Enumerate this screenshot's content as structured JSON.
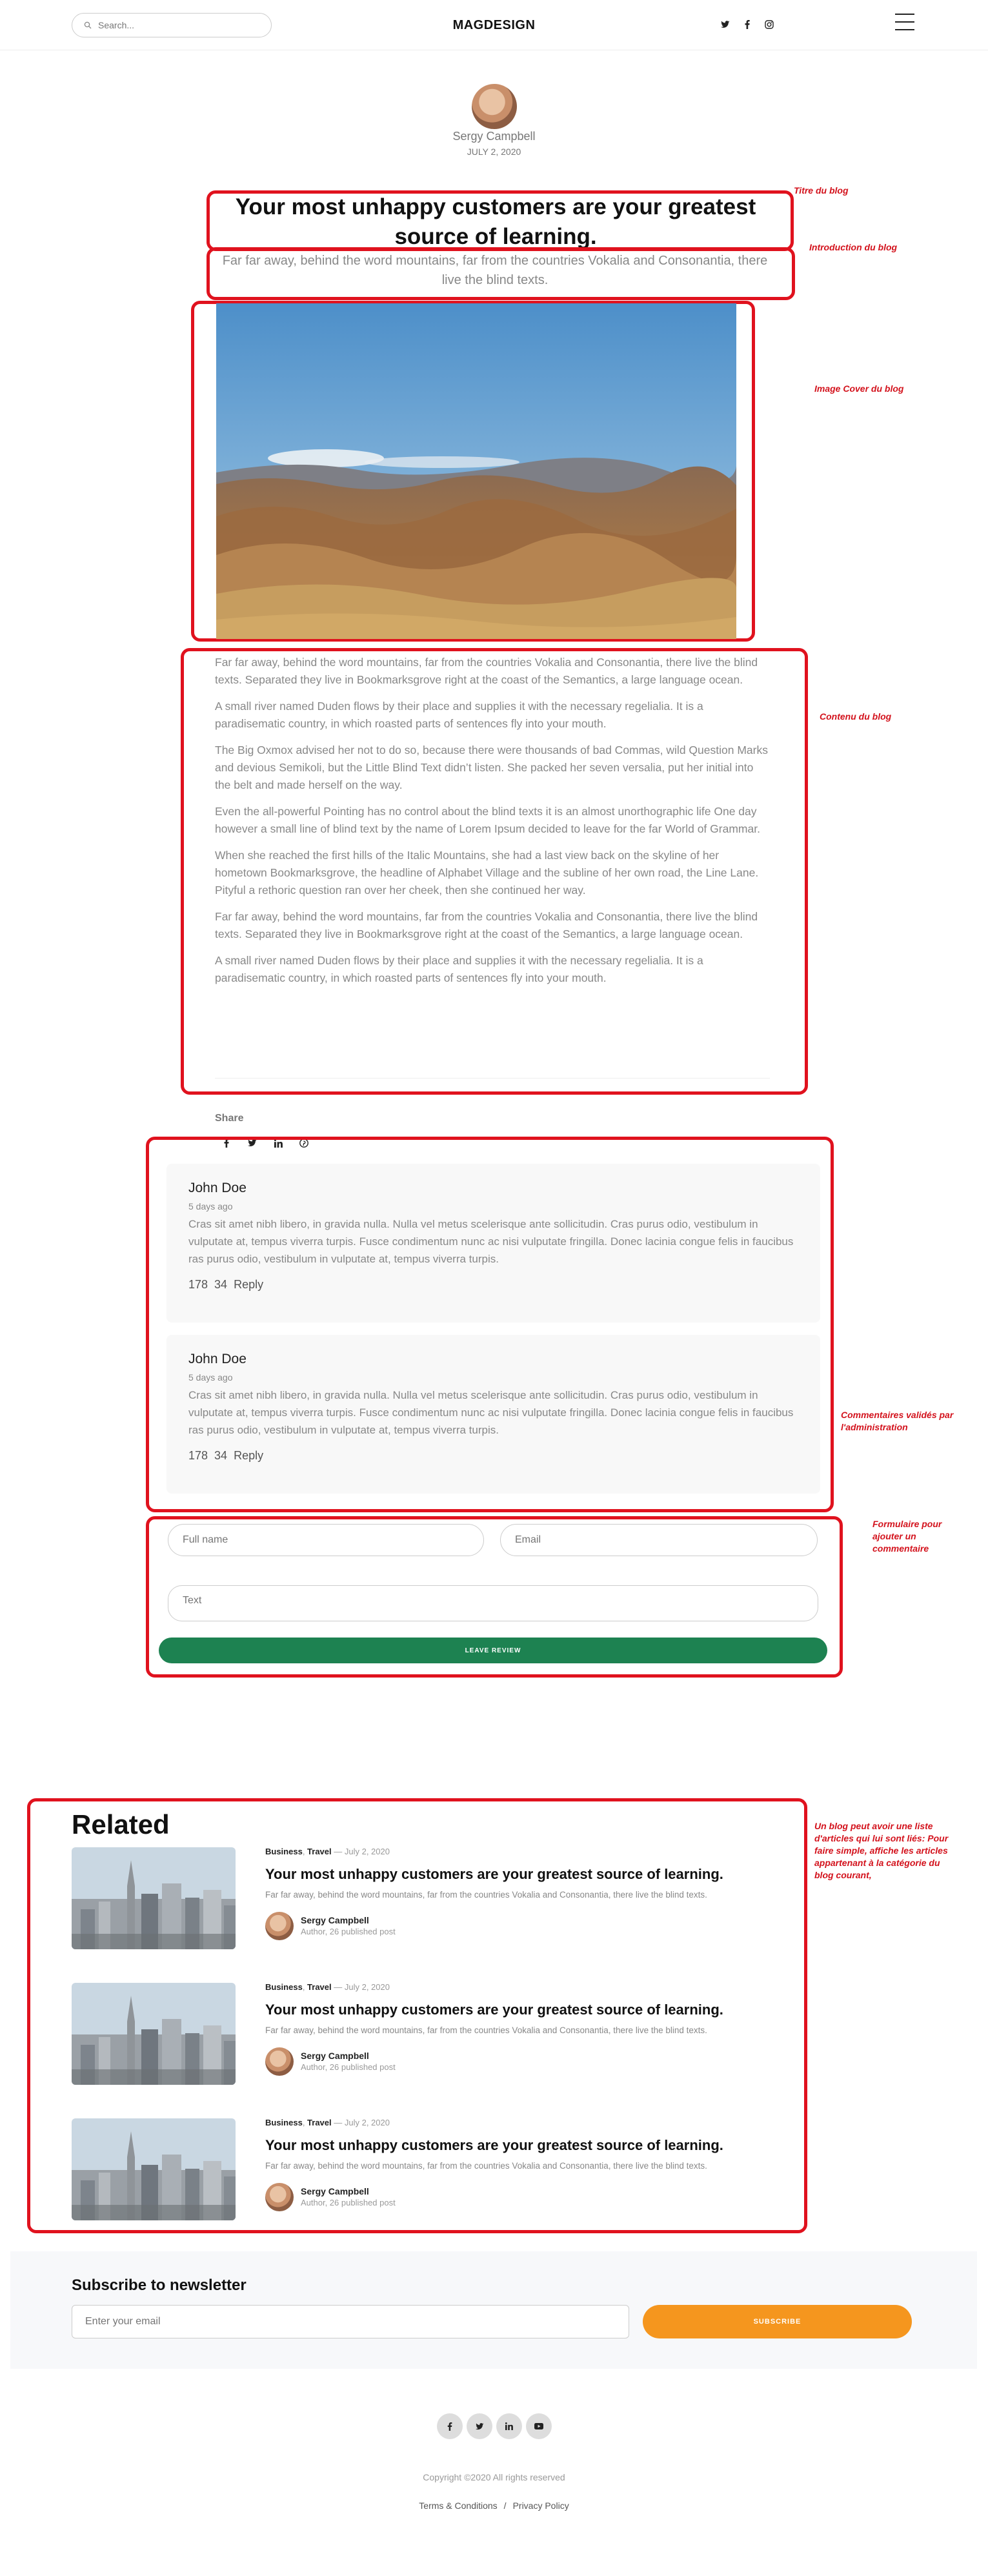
{
  "header": {
    "search_placeholder": "Search...",
    "logo": "MAGDESIGN",
    "social_icons": [
      "twitter-icon",
      "facebook-icon",
      "instagram-icon"
    ]
  },
  "post": {
    "author": "Sergy Campbell",
    "date": "JULY 2, 2020",
    "title": "Your most unhappy customers are your greatest source of learning.",
    "intro": "Far far away, behind the word mountains, far from the countries Vokalia and Consonantia, there live the blind texts.",
    "paragraphs": [
      "Far far away, behind the word mountains, far from the countries Vokalia and Consonantia, there live the blind texts. Separated they live in Bookmarksgrove right at the coast of the Semantics, a large language ocean.",
      "A small river named Duden flows by their place and supplies it with the necessary regelialia. It is a paradisematic country, in which roasted parts of sentences fly into your mouth.",
      "The Big Oxmox advised her not to do so, because there were thousands of bad Commas, wild Question Marks and devious Semikoli, but the Little Blind Text didn’t listen. She packed her seven versalia, put her initial into the belt and made herself on the way.",
      "Even the all-powerful Pointing has no control about the blind texts it is an almost unorthographic life One day however a small line of blind text by the name of Lorem Ipsum decided to leave for the far World of Grammar.",
      "When she reached the first hills of the Italic Mountains, she had a last view back on the skyline of her hometown Bookmarksgrove, the headline of Alphabet Village and the subline of her own road, the Line Lane. Pityful a rethoric question ran over her cheek, then she continued her way.",
      "Far far away, behind the word mountains, far from the countries Vokalia and Consonantia, there live the blind texts. Separated they live in Bookmarksgrove right at the coast of the Semantics, a large language ocean.",
      "A small river named Duden flows by their place and supplies it with the necessary regelialia. It is a paradisematic country, in which roasted parts of sentences fly into your mouth."
    ],
    "share_label": "Share",
    "share_icons": [
      "facebook-icon",
      "twitter-icon",
      "linkedin-icon",
      "pinterest-icon"
    ]
  },
  "comments": [
    {
      "name": "John Doe",
      "date": "5 days ago",
      "text": "Cras sit amet nibh libero, in gravida nulla. Nulla vel metus scelerisque ante sollicitudin. Cras purus odio, vestibulum in vulputate at, tempus viverra turpis. Fusce condimentum nunc ac nisi vulputate fringilla. Donec lacinia congue felis in faucibus ras purus odio, vestibulum in vulputate at, tempus viverra turpis.",
      "likes": "178",
      "replies": "34",
      "reply_label": "Reply"
    },
    {
      "name": "John Doe",
      "date": "5 days ago",
      "text": "Cras sit amet nibh libero, in gravida nulla. Nulla vel metus scelerisque ante sollicitudin. Cras purus odio, vestibulum in vulputate at, tempus viverra turpis. Fusce condimentum nunc ac nisi vulputate fringilla. Donec lacinia congue felis in faucibus ras purus odio, vestibulum in vulputate at, tempus viverra turpis.",
      "likes": "178",
      "replies": "34",
      "reply_label": "Reply"
    }
  ],
  "comment_form": {
    "fullname_placeholder": "Full name",
    "email_placeholder": "Email",
    "text_placeholder": "Text",
    "submit_label": "LEAVE REVIEW"
  },
  "related": {
    "heading": "Related",
    "items": [
      {
        "category1": "Business",
        "category2": "Travel",
        "date": "— July 2, 2020",
        "title": "Your most unhappy customers are your greatest source of learning.",
        "excerpt": "Far far away, behind the word mountains, far from the countries Vokalia and Consonantia, there live the blind texts.",
        "author": "Sergy Campbell",
        "role": "Author, 26 published post"
      },
      {
        "category1": "Business",
        "category2": "Travel",
        "date": "— July 2, 2020",
        "title": "Your most unhappy customers are your greatest source of learning.",
        "excerpt": "Far far away, behind the word mountains, far from the countries Vokalia and Consonantia, there live the blind texts.",
        "author": "Sergy Campbell",
        "role": "Author, 26 published post"
      },
      {
        "category1": "Business",
        "category2": "Travel",
        "date": "— July 2, 2020",
        "title": "Your most unhappy customers are your greatest source of learning.",
        "excerpt": "Far far away, behind the word mountains, far from the countries Vokalia and Consonantia, there live the blind texts.",
        "author": "Sergy Campbell",
        "role": "Author, 26 published post"
      }
    ]
  },
  "newsletter": {
    "title": "Subscribe to newsletter",
    "placeholder": "Enter your email",
    "button": "SUBSCRIBE"
  },
  "footer": {
    "social_icons": [
      "facebook-icon",
      "twitter-icon",
      "linkedin-icon",
      "youtube-icon"
    ],
    "copyright": "Copyright ©2020 All rights reserved",
    "terms": "Terms & Conditions",
    "separator": "/",
    "privacy": "Privacy Policy"
  },
  "annotations": {
    "title": "Titre du blog",
    "intro": "Introduction du blog",
    "cover": "Image Cover du blog",
    "content": "Contenu du blog",
    "comments": "Commentaires validés par l'administration",
    "form": "Formulaire pour ajouter un commentaire",
    "related": "Un blog peut avoir une liste d'articles qui lui sont liés: Pour faire simple, affiche les articles appartenant à la catégorie du blog courant,"
  },
  "colors": {
    "annotation_red": "#e0121e",
    "review_button": "#1d8251",
    "subscribe_button": "#f5961e"
  }
}
